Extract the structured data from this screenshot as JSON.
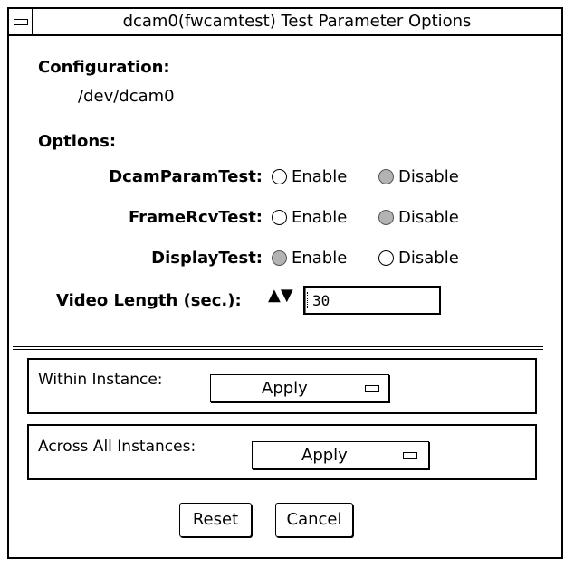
{
  "window": {
    "title": "dcam0(fwcamtest) Test Parameter Options"
  },
  "configuration": {
    "heading": "Configuration:",
    "device": "/dev/dcam0"
  },
  "options": {
    "heading": "Options:",
    "rows": [
      {
        "label": "DcamParamTest:",
        "enable": "Enable",
        "disable": "Disable",
        "selected": "Disable"
      },
      {
        "label": "FrameRcvTest:",
        "enable": "Enable",
        "disable": "Disable",
        "selected": "Disable"
      },
      {
        "label": "DisplayTest:",
        "enable": "Enable",
        "disable": "Disable",
        "selected": "Enable"
      }
    ],
    "video_length": {
      "label": "Video Length (sec.):",
      "up_arrow": "▲",
      "down_arrow": "▼",
      "value": "30"
    }
  },
  "within_instance": {
    "label": "Within Instance:",
    "button": "Apply"
  },
  "across_instances": {
    "label": "Across All Instances:",
    "button": "Apply"
  },
  "buttons": {
    "reset": "Reset",
    "cancel": "Cancel"
  }
}
